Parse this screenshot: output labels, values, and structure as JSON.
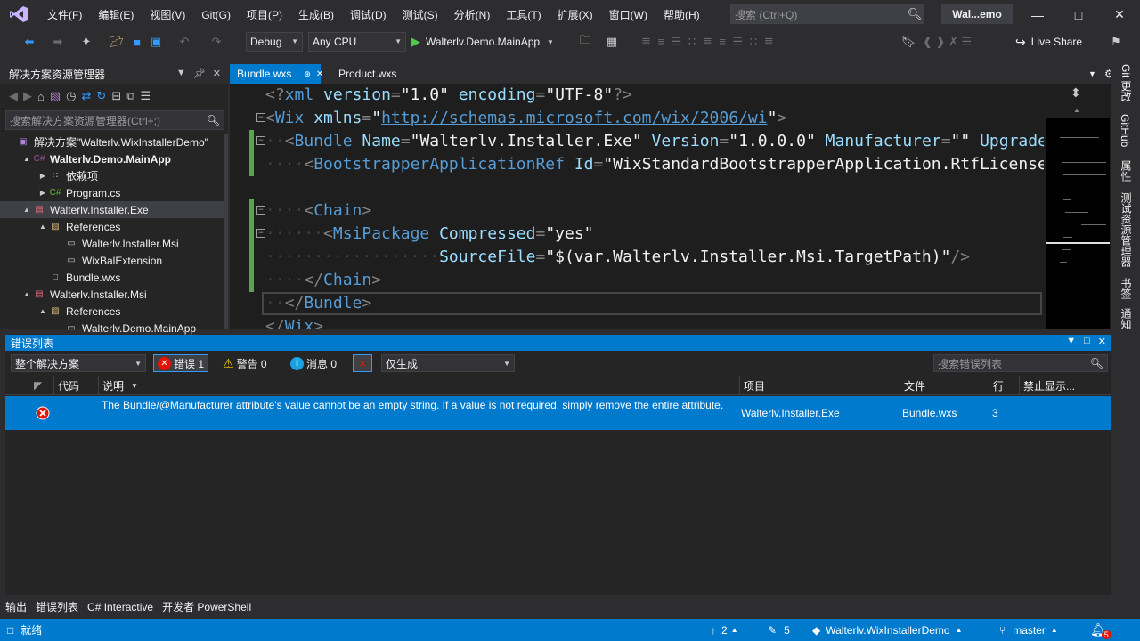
{
  "menu": [
    "文件(F)",
    "编辑(E)",
    "视图(V)",
    "Git(G)",
    "项目(P)",
    "生成(B)",
    "调试(D)",
    "测试(S)",
    "分析(N)",
    "工具(T)",
    "扩展(X)",
    "窗口(W)",
    "帮助(H)"
  ],
  "search": {
    "placeholder": "搜索 (Ctrl+Q)"
  },
  "solution_title": "Wal...emo",
  "toolbar": {
    "config": "Debug",
    "platform": "Any CPU",
    "run_target": "Walterlv.Demo.MainApp",
    "live_share": "Live Share"
  },
  "solution_explorer": {
    "title": "解决方案资源管理器",
    "search_placeholder": "搜索解决方案资源管理器(Ctrl+;)",
    "items": [
      {
        "label": "解决方案\"Walterlv.WixInstallerDemo\"",
        "depth": 0,
        "expander": "",
        "icon": "solution-icon"
      },
      {
        "label": "Walterlv.Demo.MainApp",
        "depth": 1,
        "expander": "▲",
        "icon": "csharp-project-icon",
        "bold": true
      },
      {
        "label": "依赖项",
        "depth": 2,
        "expander": "▶",
        "icon": "dependencies-icon"
      },
      {
        "label": "Program.cs",
        "depth": 2,
        "expander": "▶",
        "icon": "csharp-file-icon"
      },
      {
        "label": "Walterlv.Installer.Exe",
        "depth": 1,
        "expander": "▲",
        "icon": "wix-project-icon",
        "selected": true
      },
      {
        "label": "References",
        "depth": 2,
        "expander": "▲",
        "icon": "references-icon"
      },
      {
        "label": "Walterlv.Installer.Msi",
        "depth": 3,
        "expander": "",
        "icon": "reference-icon"
      },
      {
        "label": "WixBalExtension",
        "depth": 3,
        "expander": "",
        "icon": "reference-icon"
      },
      {
        "label": "Bundle.wxs",
        "depth": 2,
        "expander": "",
        "icon": "wxs-file-icon"
      },
      {
        "label": "Walterlv.Installer.Msi",
        "depth": 1,
        "expander": "▲",
        "icon": "wix-project-icon"
      },
      {
        "label": "References",
        "depth": 2,
        "expander": "▲",
        "icon": "references-icon"
      },
      {
        "label": "Walterlv.Demo.MainApp",
        "depth": 3,
        "expander": "",
        "icon": "reference-icon"
      }
    ]
  },
  "editor": {
    "tabs": [
      "Bundle.wxs",
      "Product.wxs"
    ],
    "lines": [
      "<?xml version=\"1.0\" encoding=\"UTF-8\"?>",
      "<Wix xmlns=\"http://schemas.microsoft.com/wix/2006/wi\">",
      "  <Bundle Name=\"Walterlv.Installer.Exe\" Version=\"1.0.0.0\" Manufacturer=\"\" UpgradeCode=",
      "    <BootstrapperApplicationRef Id=\"WixStandardBootstrapperApplication.RtfLicense\"",
      "",
      "    <Chain>",
      "      <MsiPackage Compressed=\"yes\"",
      "                  SourceFile=\"$(var.Walterlv.Installer.Msi.TargetPath)\"/>",
      "    </Chain>",
      "  </Bundle>",
      "</Wix>"
    ]
  },
  "right_rail": [
    "Git 更改",
    "GitHub",
    "属性",
    "测试资源管理器",
    "书签",
    "通知"
  ],
  "error_list": {
    "title": "错误列表",
    "scope": "整个解决方案",
    "errors_label": "错误 1",
    "warnings_label": "警告 0",
    "messages_label": "消息 0",
    "build_filter": "仅生成",
    "search_placeholder": "搜索错误列表",
    "columns": {
      "code": "代码",
      "description": "说明",
      "project": "项目",
      "file": "文件",
      "line": "行",
      "suppress": "禁止显示..."
    },
    "rows": [
      {
        "description": "The Bundle/@Manufacturer attribute's value cannot be an empty string. If a value is not required, simply remove the entire attribute.",
        "project": "Walterlv.Installer.Exe",
        "file": "Bundle.wxs",
        "line": "3"
      }
    ]
  },
  "bottom_tabs": [
    "输出",
    "错误列表",
    "C# Interactive",
    "开发者 PowerShell"
  ],
  "status": {
    "ready": "就绪",
    "push_count": "2",
    "edit_count": "5",
    "repo": "Walterlv.WixInstallerDemo",
    "branch": "master",
    "notifications": "5"
  },
  "colors": {
    "accent": "#007acc",
    "background": "#1e1e1e",
    "chrome": "#2d2d30",
    "error": "#e51400",
    "warning": "#ffcc00",
    "info": "#1ba1e2",
    "git_change": "#57a64a"
  }
}
